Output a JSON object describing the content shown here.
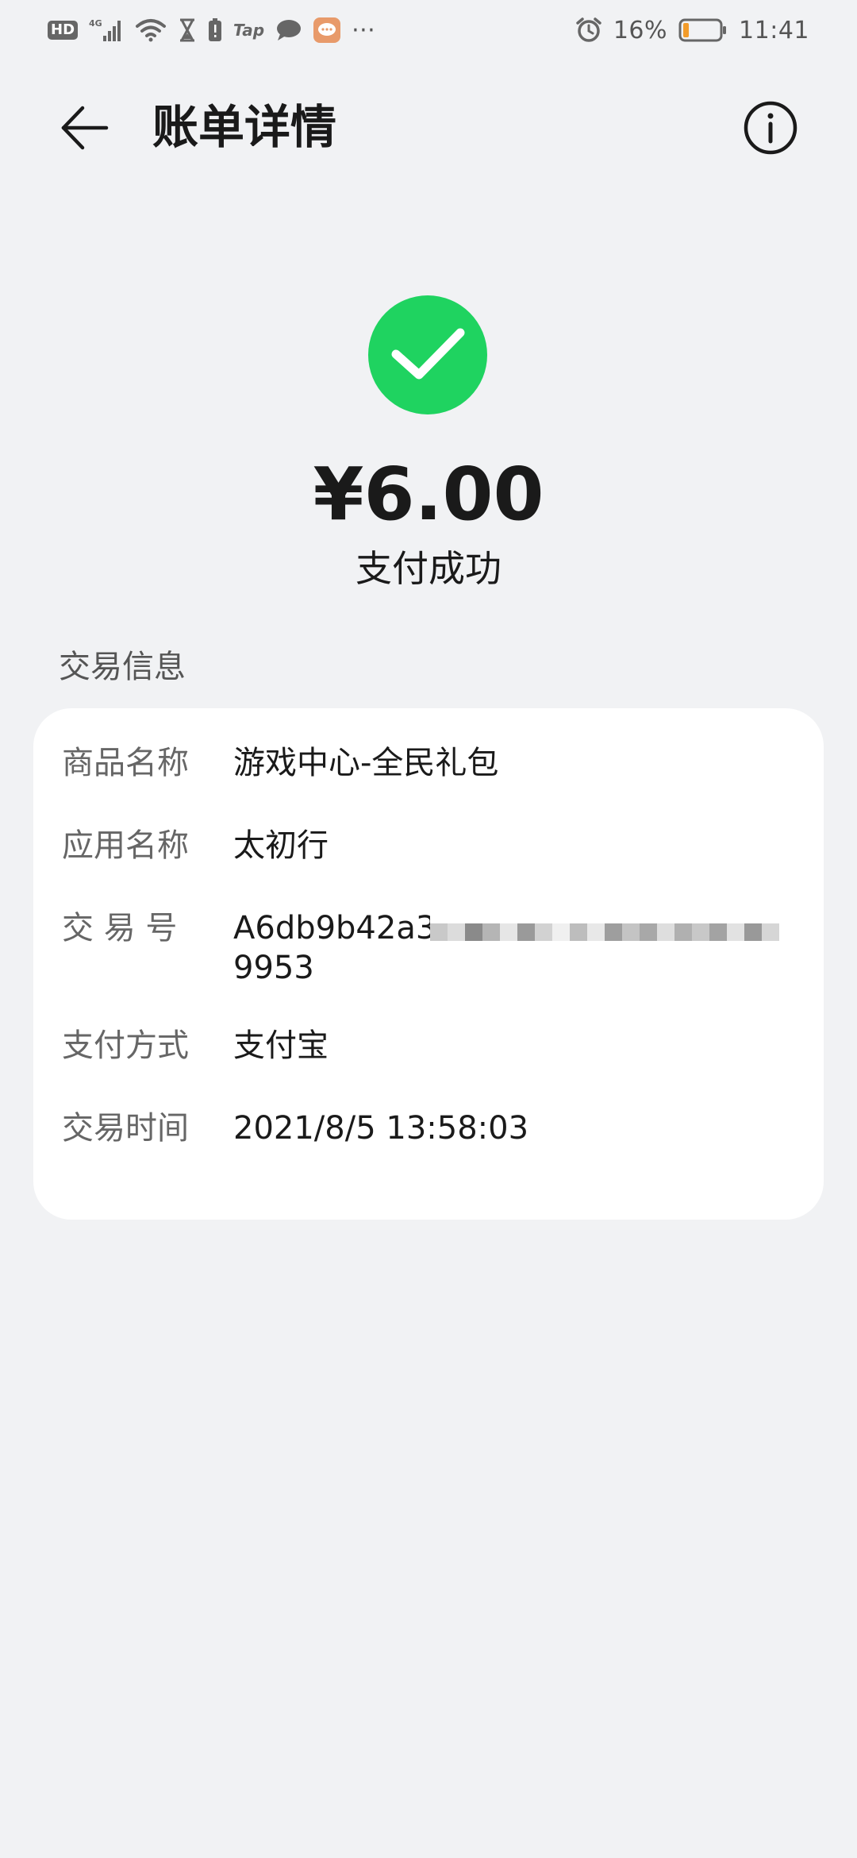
{
  "status_bar": {
    "hd": "HD",
    "network": "4G",
    "tap": "Tap",
    "more": "···",
    "battery_percent": "16%",
    "time": "11:41",
    "battery_level": 0.16
  },
  "header": {
    "title": "账单详情"
  },
  "payment": {
    "amount": "¥6.00",
    "status": "支付成功",
    "success_color": "#1fd360"
  },
  "section": {
    "label": "交易信息"
  },
  "details": {
    "product": {
      "label": "商品名称",
      "value": "游戏中心-全民礼包"
    },
    "app": {
      "label": "应用名称",
      "value": "太初行"
    },
    "transaction_id": {
      "label": "交 易 号",
      "value_line1": "A6db9b42a3",
      "value_line2": "9953"
    },
    "pay_method": {
      "label": "支付方式",
      "value": "支付宝"
    },
    "time": {
      "label": "交易时间",
      "value": "2021/8/5 13:58:03"
    }
  }
}
